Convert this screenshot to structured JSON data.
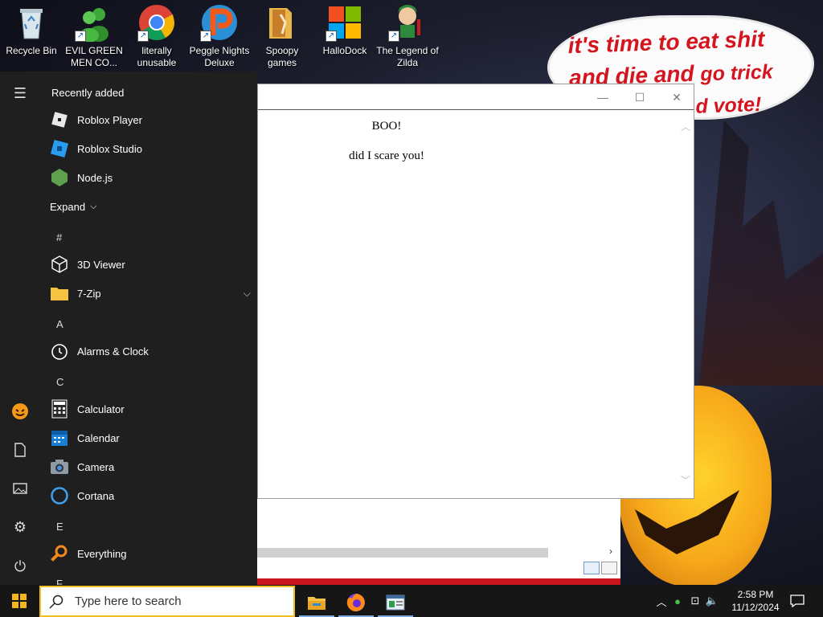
{
  "desktop": {
    "icons": [
      {
        "label": "Recycle Bin",
        "icon": "recycle-bin-icon"
      },
      {
        "label": "EVIL GREEN MEN CO...",
        "icon": "green-men-icon"
      },
      {
        "label": "literally unusable",
        "icon": "chrome-icon"
      },
      {
        "label": "Peggle Nights Deluxe",
        "icon": "peggle-icon"
      },
      {
        "label": "Spoopy games",
        "icon": "folder-icon"
      },
      {
        "label": "HalloDock",
        "icon": "windows-logo-icon"
      },
      {
        "label": "The Legend of Zilda",
        "icon": "zilda-icon"
      }
    ],
    "wallpaper_text": {
      "line1": "it's time to eat shit",
      "line2a": "and die and",
      "line2b": "go trick",
      "line3": "d vote!"
    }
  },
  "window": {
    "heading": "BOO!",
    "body": "did I scare you!"
  },
  "start_menu": {
    "recently_added_label": "Recently added",
    "recent": [
      "Roblox Player",
      "Roblox Studio",
      "Node.js"
    ],
    "expand_label": "Expand",
    "sections": [
      {
        "letter": "#",
        "apps": [
          "3D Viewer",
          "7-Zip"
        ]
      },
      {
        "letter": "A",
        "apps": [
          "Alarms & Clock"
        ]
      },
      {
        "letter": "C",
        "apps": [
          "Calculator",
          "Calendar",
          "Camera",
          "Cortana"
        ]
      },
      {
        "letter": "E",
        "apps": [
          "Everything"
        ]
      }
    ],
    "trailing_letter": "F"
  },
  "taskbar": {
    "search_placeholder": "Type here to search",
    "time": "2:58 PM",
    "date": "11/12/2024"
  },
  "colors": {
    "accent": "#f0c020",
    "bubble_text": "#d4141e",
    "start_bg": "#1f1f1f"
  }
}
